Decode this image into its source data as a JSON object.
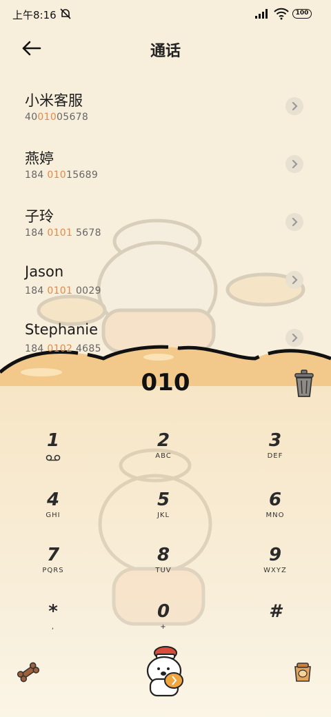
{
  "status": {
    "time": "上午8:16",
    "battery": "100"
  },
  "header": {
    "title": "通话"
  },
  "contacts": [
    {
      "name": "小米客服",
      "num_pre": "40",
      "num_hl": "010",
      "num_post": "05678"
    },
    {
      "name": "燕婷",
      "num_pre": "184 ",
      "num_hl": "010",
      "num_post": "15689"
    },
    {
      "name": "子玲",
      "num_pre": "184 ",
      "num_hl": "0101",
      "num_post": " 5678"
    },
    {
      "name": "Jason",
      "num_pre": "184 ",
      "num_hl": "0101",
      "num_post": " 0029"
    },
    {
      "name": "Stephanie",
      "num_pre": "184 ",
      "num_hl": "0102",
      "num_post": " 4685"
    }
  ],
  "dial": {
    "digits": "010"
  },
  "keypad": [
    {
      "n": "1",
      "l": ""
    },
    {
      "n": "2",
      "l": "ABC"
    },
    {
      "n": "3",
      "l": "DEF"
    },
    {
      "n": "4",
      "l": "GHI"
    },
    {
      "n": "5",
      "l": "JKL"
    },
    {
      "n": "6",
      "l": "MNO"
    },
    {
      "n": "7",
      "l": "PQRS"
    },
    {
      "n": "8",
      "l": "TUV"
    },
    {
      "n": "9",
      "l": "WXYZ"
    },
    {
      "n": "*",
      "l": ","
    },
    {
      "n": "0",
      "l": "+"
    },
    {
      "n": "#",
      "l": ""
    }
  ],
  "icons": {
    "back": "arrow-left-icon",
    "voicemail": "voicemail-icon",
    "delete": "trash-can-icon",
    "left_tool": "dog-bone-icon",
    "right_tool": "bread-bag-icon",
    "call": "chef-mascot-call-icon"
  },
  "colors": {
    "highlight": "#e3894a",
    "background": "#f7efdc",
    "bread": "#f2c98a"
  }
}
